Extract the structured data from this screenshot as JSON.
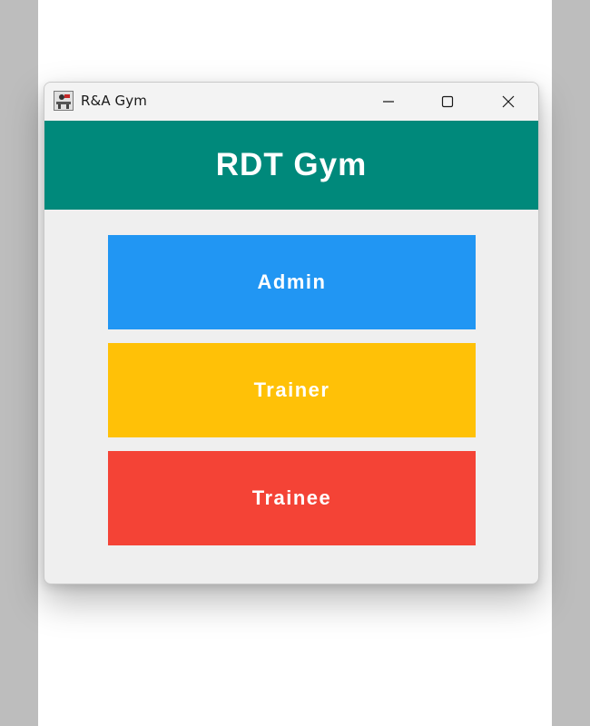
{
  "window": {
    "title": "R&A Gym",
    "controls": {
      "minimize": "minimize-icon",
      "maximize": "maximize-icon",
      "close": "close-icon"
    },
    "app_icon": "gym-app-icon"
  },
  "header": {
    "title": "RDT Gym",
    "color": "#00897b"
  },
  "roles": [
    {
      "label": "Admin",
      "color": "#2196f3"
    },
    {
      "label": "Trainer",
      "color": "#ffc107"
    },
    {
      "label": "Trainee",
      "color": "#f44336"
    }
  ]
}
